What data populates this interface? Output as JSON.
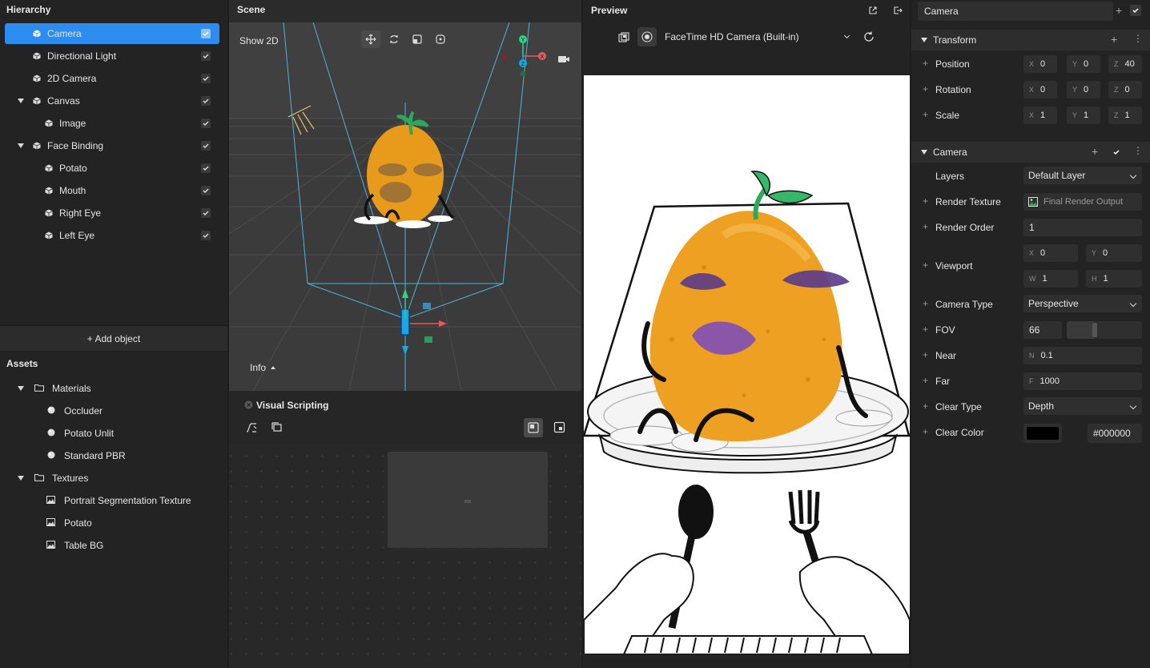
{
  "hierarchy": {
    "title": "Hierarchy",
    "items": [
      {
        "label": "Camera",
        "selected": true
      },
      {
        "label": "Directional Light"
      },
      {
        "label": "2D Camera"
      },
      {
        "label": "Canvas",
        "expanded": true
      },
      {
        "label": "Image"
      },
      {
        "label": "Face Binding",
        "expanded": true
      },
      {
        "label": "Potato"
      },
      {
        "label": "Mouth"
      },
      {
        "label": "Right Eye"
      },
      {
        "label": "Left Eye"
      }
    ],
    "add_object": "+ Add object"
  },
  "assets": {
    "title": "Assets",
    "items": [
      {
        "label": "Materials",
        "icon": "folder-icon"
      },
      {
        "label": "Occluder",
        "icon": "material-sphere-icon"
      },
      {
        "label": "Potato Unlit",
        "icon": "material-sphere-icon"
      },
      {
        "label": "Standard PBR",
        "icon": "material-sphere-icon"
      },
      {
        "label": "Textures",
        "icon": "folder-icon"
      },
      {
        "label": "Portrait Segmentation Texture",
        "icon": "image-icon"
      },
      {
        "label": "Potato",
        "icon": "image-icon"
      },
      {
        "label": "Table BG",
        "icon": "image-icon"
      }
    ]
  },
  "scene": {
    "title": "Scene",
    "show_2d": "Show 2D",
    "info": "Info",
    "gizmo": {
      "y": "Y",
      "z": "Z",
      "x": "X"
    }
  },
  "visual_scripting": {
    "title": "Visual Scripting"
  },
  "preview": {
    "title": "Preview",
    "camera_source": "FaceTime HD Camera (Built-in)"
  },
  "inspector": {
    "object_name": "Camera",
    "transform": {
      "title": "Transform",
      "position": {
        "label": "Position",
        "x": "0",
        "y": "0",
        "z": "40"
      },
      "rotation": {
        "label": "Rotation",
        "x": "0",
        "y": "0",
        "z": "0"
      },
      "scale": {
        "label": "Scale",
        "x": "1",
        "y": "1",
        "z": "1"
      }
    },
    "camera": {
      "title": "Camera",
      "layers": {
        "label": "Layers",
        "value": "Default Layer"
      },
      "render_texture": {
        "label": "Render Texture",
        "value": "Final Render Output"
      },
      "render_order": {
        "label": "Render Order",
        "value": "1"
      },
      "viewport": {
        "label": "Viewport",
        "x": "0",
        "y": "0",
        "w": "1",
        "h": "1"
      },
      "camera_type": {
        "label": "Camera Type",
        "value": "Perspective"
      },
      "fov": {
        "label": "FOV",
        "value": "66"
      },
      "near": {
        "label": "Near",
        "value": "0.1"
      },
      "far": {
        "label": "Far",
        "value": "1000"
      },
      "clear_type": {
        "label": "Clear Type",
        "value": "Depth"
      },
      "clear_color": {
        "label": "Clear Color",
        "value": "#000000",
        "swatch": "#000000"
      }
    },
    "axes": {
      "x": "X",
      "y": "Y",
      "z": "Z",
      "w": "W",
      "h": "H",
      "n": "N",
      "f": "F"
    }
  },
  "colors": {
    "accent": "#2d8cf0",
    "panel": "#232323",
    "potato": "#e89a1a",
    "frustum": "#4fb3d9"
  }
}
